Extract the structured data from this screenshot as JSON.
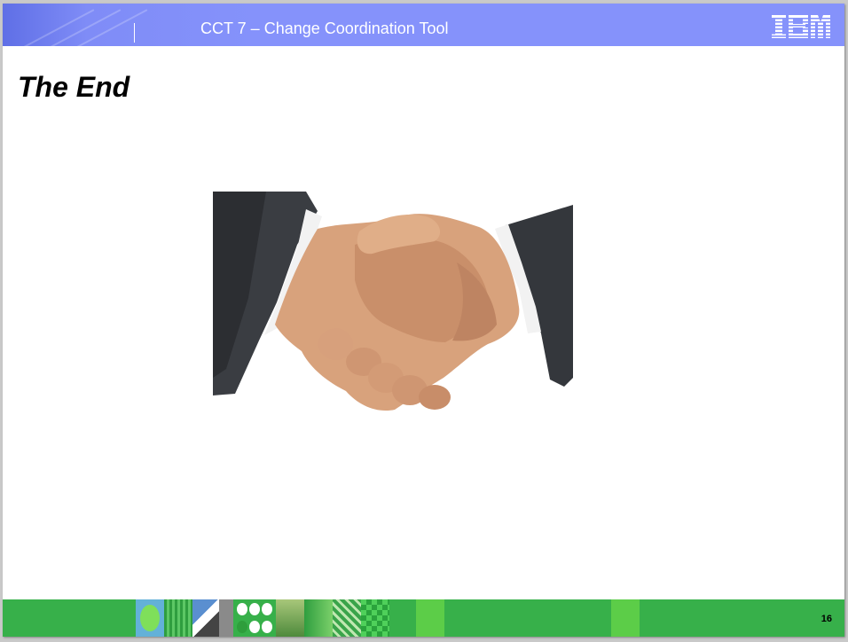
{
  "header": {
    "title": "CCT 7 – Change Coordination Tool",
    "logo_text": "IBM",
    "background_color": "#8592fb"
  },
  "slide": {
    "title": "The End",
    "image": "handshake-image"
  },
  "footer": {
    "page_number": "16",
    "background_color": "#37b04a"
  }
}
